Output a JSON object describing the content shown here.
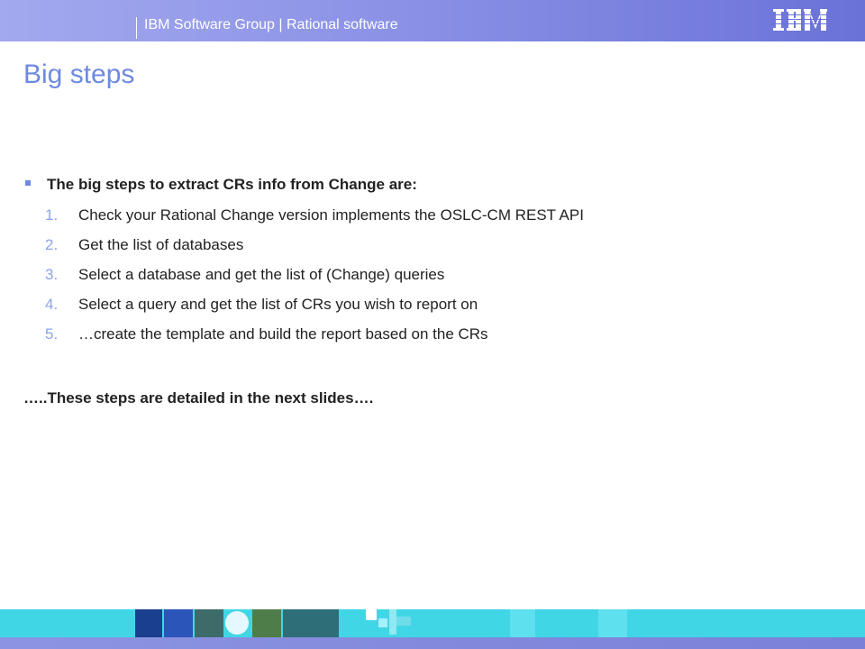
{
  "header": {
    "text": "IBM Software Group | Rational software",
    "logo_alt": "IBM",
    "colors": {
      "band_left": "#a3a9ee",
      "band_right": "#6a72d8"
    }
  },
  "title": "Big steps",
  "main_bullet": "The big steps to extract CRs info from Change are:",
  "steps": [
    {
      "num": "1.",
      "text": "Check your Rational Change version implements the OSLC-CM REST API"
    },
    {
      "num": "2.",
      "text": "Get the list of databases"
    },
    {
      "num": "3.",
      "text": "Select a database and get the list of (Change) queries"
    },
    {
      "num": "4.",
      "text": "Select a query and get the list of CRs you wish to report on"
    },
    {
      "num": "5.",
      "text": "…create the template and build the report based on the CRs"
    }
  ],
  "footer_note": "…..These steps are detailed in the next slides….",
  "colors": {
    "title": "#6e8ae0",
    "step_number": "#8aa3f0",
    "body_text": "#222222",
    "bottom_band": "#41d6e6"
  }
}
